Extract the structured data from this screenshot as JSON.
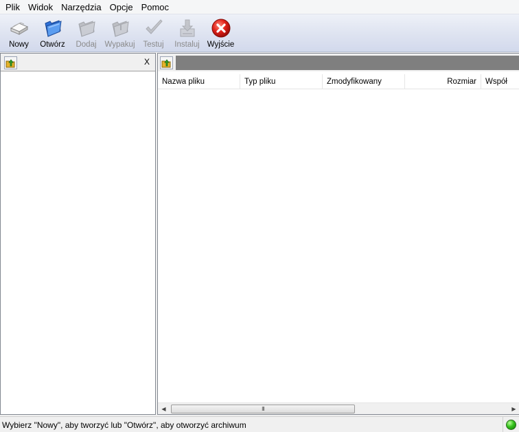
{
  "menu": {
    "items": [
      "Plik",
      "Widok",
      "Narzędzia",
      "Opcje",
      "Pomoc"
    ]
  },
  "toolbar": {
    "buttons": [
      {
        "label": "Nowy",
        "icon": "new-archive-icon",
        "enabled": true
      },
      {
        "label": "Otwórz",
        "icon": "open-folder-icon",
        "enabled": true
      },
      {
        "label": "Dodaj",
        "icon": "add-files-icon",
        "enabled": false
      },
      {
        "label": "Wypakuj",
        "icon": "extract-icon",
        "enabled": false
      },
      {
        "label": "Testuj",
        "icon": "test-check-icon",
        "enabled": false
      },
      {
        "label": "Instaluj",
        "icon": "install-icon",
        "enabled": false
      },
      {
        "label": "Wyjście",
        "icon": "exit-icon",
        "enabled": true
      }
    ]
  },
  "left_panel": {
    "close_label": "X"
  },
  "file_list": {
    "columns": [
      "Nazwa pliku",
      "Typ pliku",
      "Zmodyfikowany",
      "Rozmiar",
      "Współ"
    ],
    "rows": []
  },
  "scrollbar": {
    "thumb_grip": "III"
  },
  "status": {
    "text": "Wybierz \"Nowy\", aby tworzyć lub \"Otwórz\", aby otworzyć archiwum",
    "indicator_color": "#2fbf1a"
  }
}
